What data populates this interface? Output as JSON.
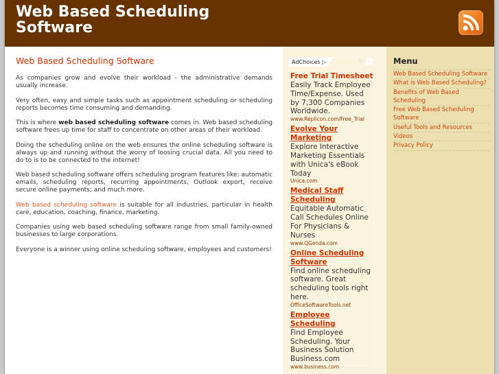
{
  "header": {
    "site_title": "Web Based Scheduling Software",
    "rss_icon": "rss-feed-icon"
  },
  "main": {
    "heading": "Web Based Scheduling Software",
    "paragraphs": {
      "p1": "As companies grow and evolve their workload - the administrative demands usually increase.",
      "p2": "Very often, easy and simple tasks such as appointment scheduling or scheduling reports becomes time consuming and demanding.",
      "p3_before": "This is where ",
      "p3_bold": "web based scheduling software",
      "p3_after": " comes in. Web based scheduling software frees up time for staff to concentrate on other areas of their workload.",
      "p4": "Doing the scheduling online on the web ensures the online scheduling software is always up and running without the worry of loosing crucial data. All you need to do to is to be connected to the internet!",
      "p5": "Web based scheduling software offers scheduling program features like: automatic emails, scheduling reports, recurring appointments, Outlook export, receive secure online payments; and much more.",
      "p6_link": "Web based scheduling software",
      "p6_after": " is suitable for all industries, particular in health care, education, coaching, finance, marketing.",
      "p7": "Companies using web based scheduling software range from small family-owned businesses to large corporations.",
      "p8": "Everyone is a winner using online scheduling software, employees and customers!"
    }
  },
  "ads": {
    "adchoices_label": "AdChoices",
    "adchoices_icon": "▷",
    "close_icon": "›",
    "items": [
      {
        "title": "Free Trial Timesheet",
        "desc": "Easily Track Employee Time/Expense. Used by 7,300 Companies Worldwide.",
        "url": "www.Replicon.com/Free_Trial"
      },
      {
        "title": "Evolve Your Marketing",
        "desc": "Explore Interactive Marketing Essentials with Unica's eBook Today",
        "url": "Unica.com"
      },
      {
        "title": "Medical Staff Scheduling",
        "desc": "Equitable Automatic Call Schedules Online For Physicians & Nurses",
        "url": "www.QGenda.com"
      },
      {
        "title": "Online Scheduling Software",
        "desc": "Find online scheduling software. Great scheduling tools right here.",
        "url": "OfficeSoftwareTools.net"
      },
      {
        "title": "Employee Scheduling",
        "desc": "Find Employee Scheduling. Your Business Solution Business.com",
        "url": "www.business.com"
      }
    ]
  },
  "sidebar": {
    "menu_title": "Menu",
    "items": [
      {
        "label": "Web Based Scheduling Software"
      },
      {
        "label": "What is Web Based Scheduling?"
      },
      {
        "label": "Benefits of Web Based Scheduling"
      },
      {
        "label": "Free Web Based Scheduling Software"
      },
      {
        "label": "Useful Tools and Resources"
      },
      {
        "label": "Videos"
      },
      {
        "label": "Privacy Policy"
      }
    ]
  },
  "colors": {
    "header_bg": "#663300",
    "accent": "#cc3300",
    "ad_column_bg": "#faf3de",
    "sidebar_bg": "#ece0b0"
  }
}
